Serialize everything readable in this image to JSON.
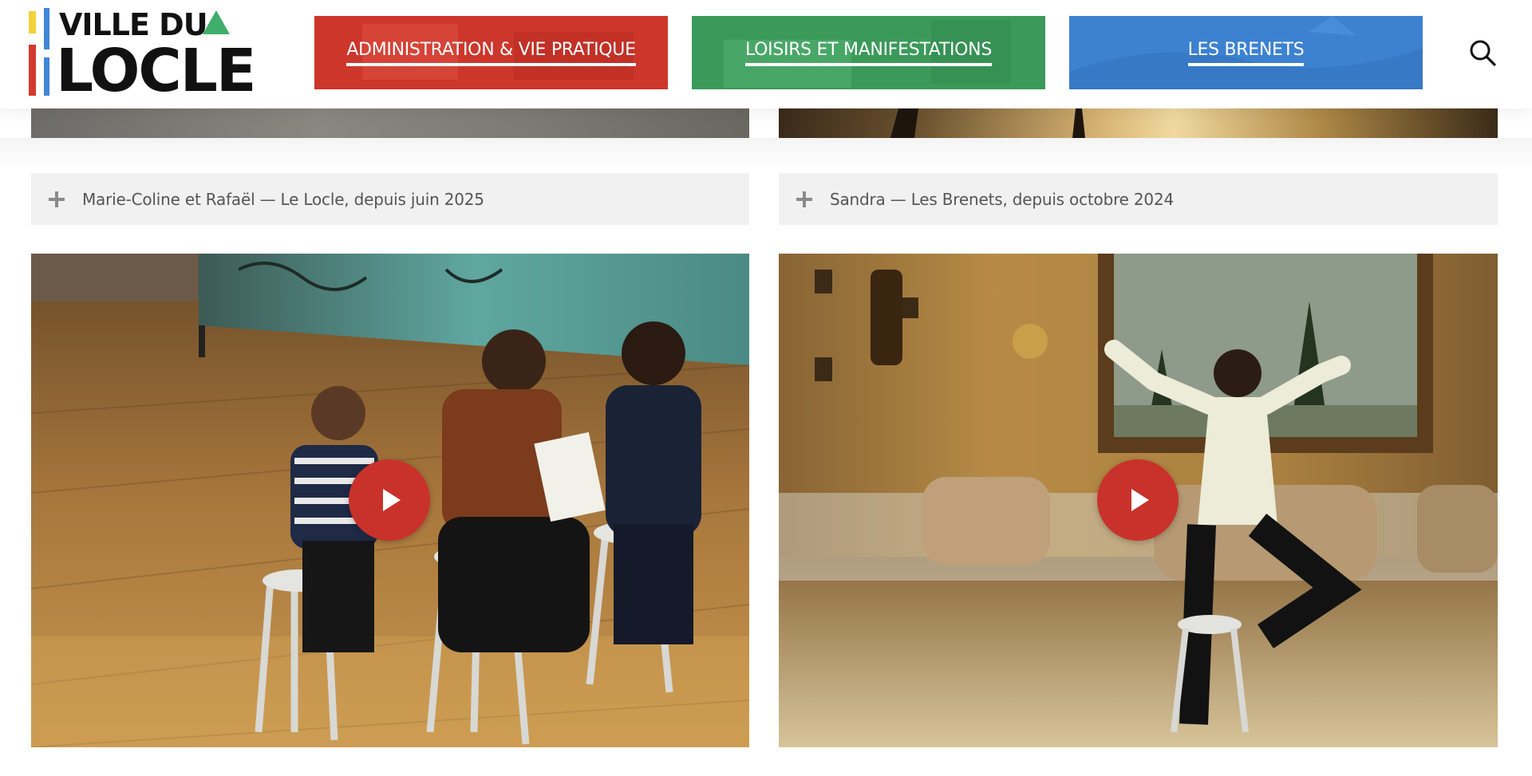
{
  "logo": {
    "line1": "VILLE DU",
    "line2": "LOCLE"
  },
  "nav": [
    {
      "label": "ADMINISTRATION & VIE PRATIQUE",
      "color": "#d2392e"
    },
    {
      "label": "LOISIRS ET MANIFESTATIONS",
      "color": "#3e9e5e"
    },
    {
      "label": "LES BRENETS",
      "color": "#3f86d6"
    }
  ],
  "search": {
    "icon": "search-icon"
  },
  "testimonials": [
    {
      "title": "Marie-Coline et Rafaël — Le Locle, depuis juin 2025",
      "icon": "plus-icon"
    },
    {
      "title": "Sandra — Les Brenets, depuis octobre 2024",
      "icon": "plus-icon"
    }
  ],
  "videos": [
    {
      "icon": "play-icon"
    },
    {
      "icon": "play-icon"
    }
  ],
  "colors": {
    "red": "#d2392e",
    "green": "#3e9e5e",
    "blue": "#3f86d6",
    "yellow": "#f2d13b",
    "play": "#c8322a"
  }
}
